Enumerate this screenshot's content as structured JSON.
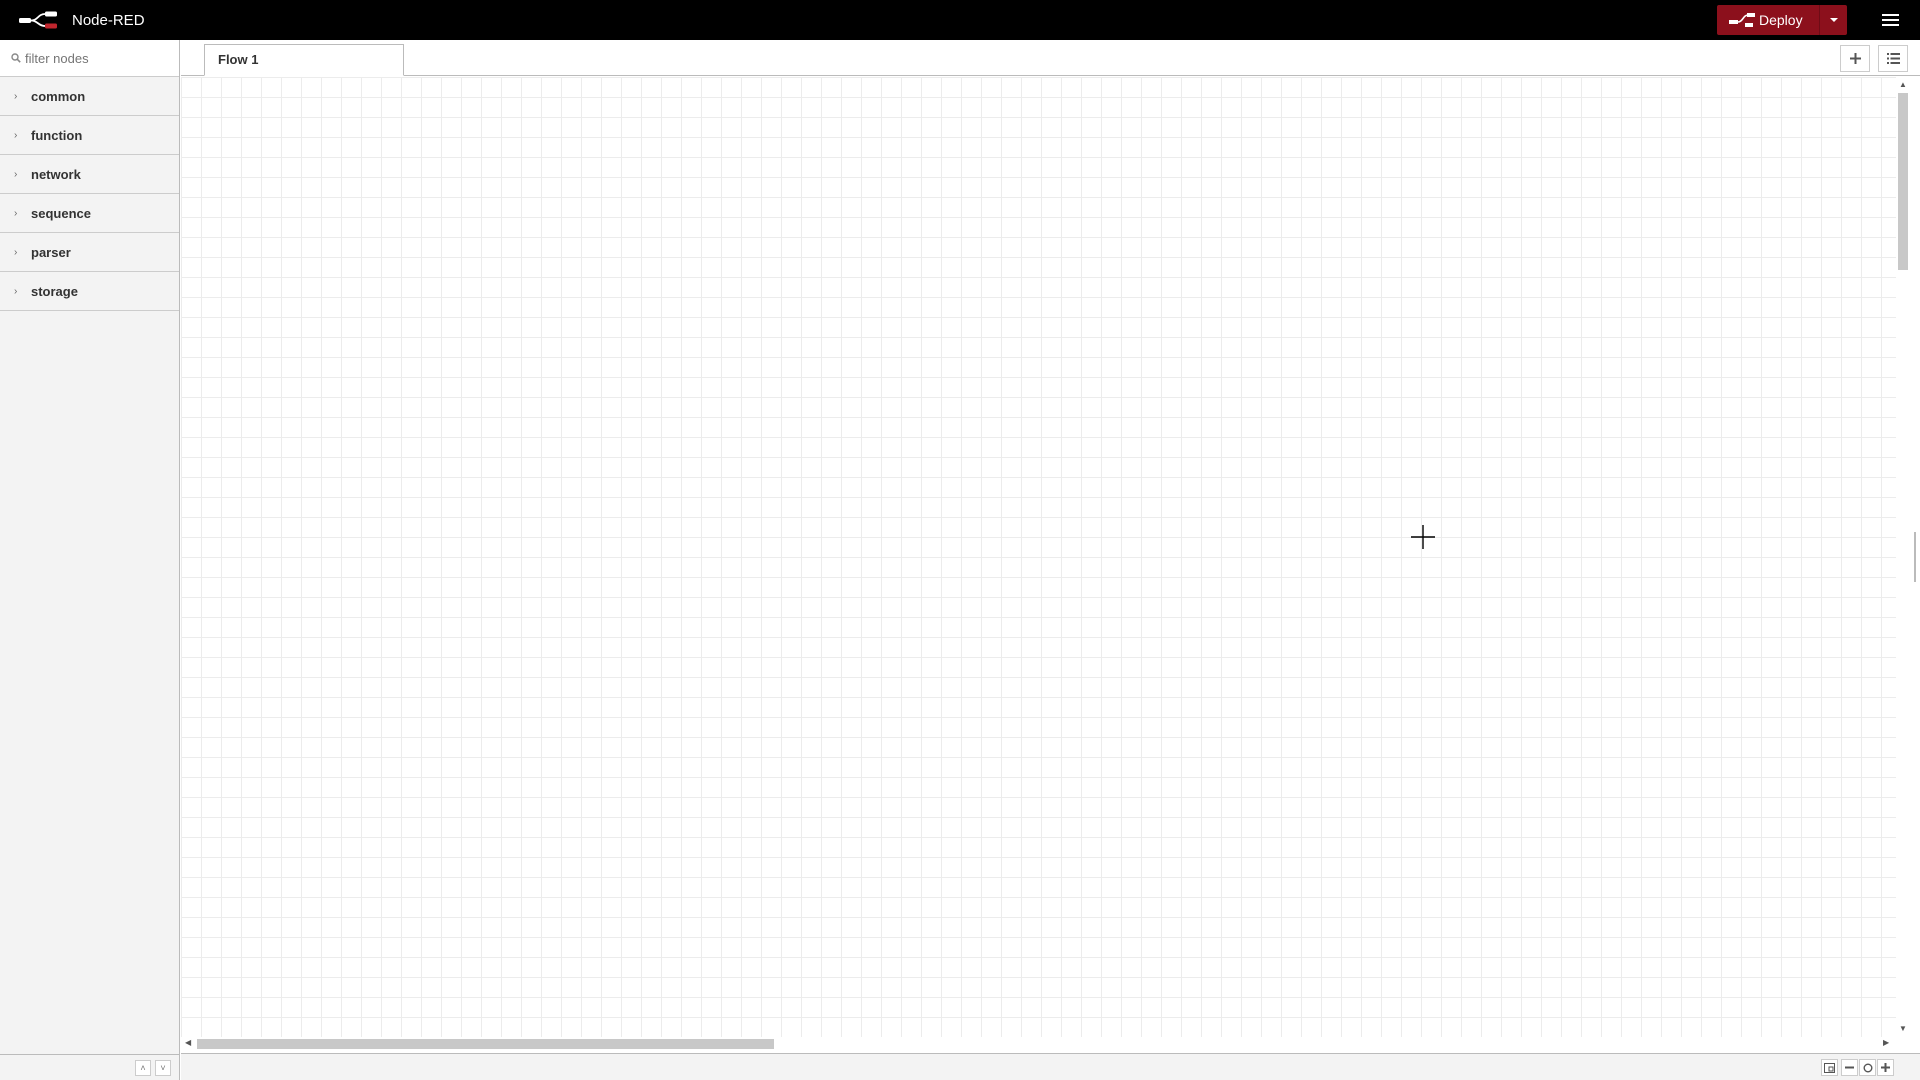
{
  "header": {
    "app_title": "Node-RED",
    "deploy_label": "Deploy",
    "brand_color": "#8c101c"
  },
  "palette": {
    "search_placeholder": "filter nodes",
    "categories": [
      {
        "label": "common"
      },
      {
        "label": "function"
      },
      {
        "label": "network"
      },
      {
        "label": "sequence"
      },
      {
        "label": "parser"
      },
      {
        "label": "storage"
      }
    ]
  },
  "tabs": [
    {
      "label": "Flow 1"
    }
  ],
  "icons": {
    "logo": "node-red-logo-icon",
    "deploy": "deploy-icon",
    "deploy_menu": "caret-down-icon",
    "main_menu": "hamburger-menu-icon",
    "search": "search-icon",
    "add_flow": "plus-icon",
    "flow_list": "list-icon",
    "zoom_out": "minus-icon",
    "zoom_reset": "circle-icon",
    "zoom_in": "plus-icon",
    "navigator": "navigator-icon"
  }
}
